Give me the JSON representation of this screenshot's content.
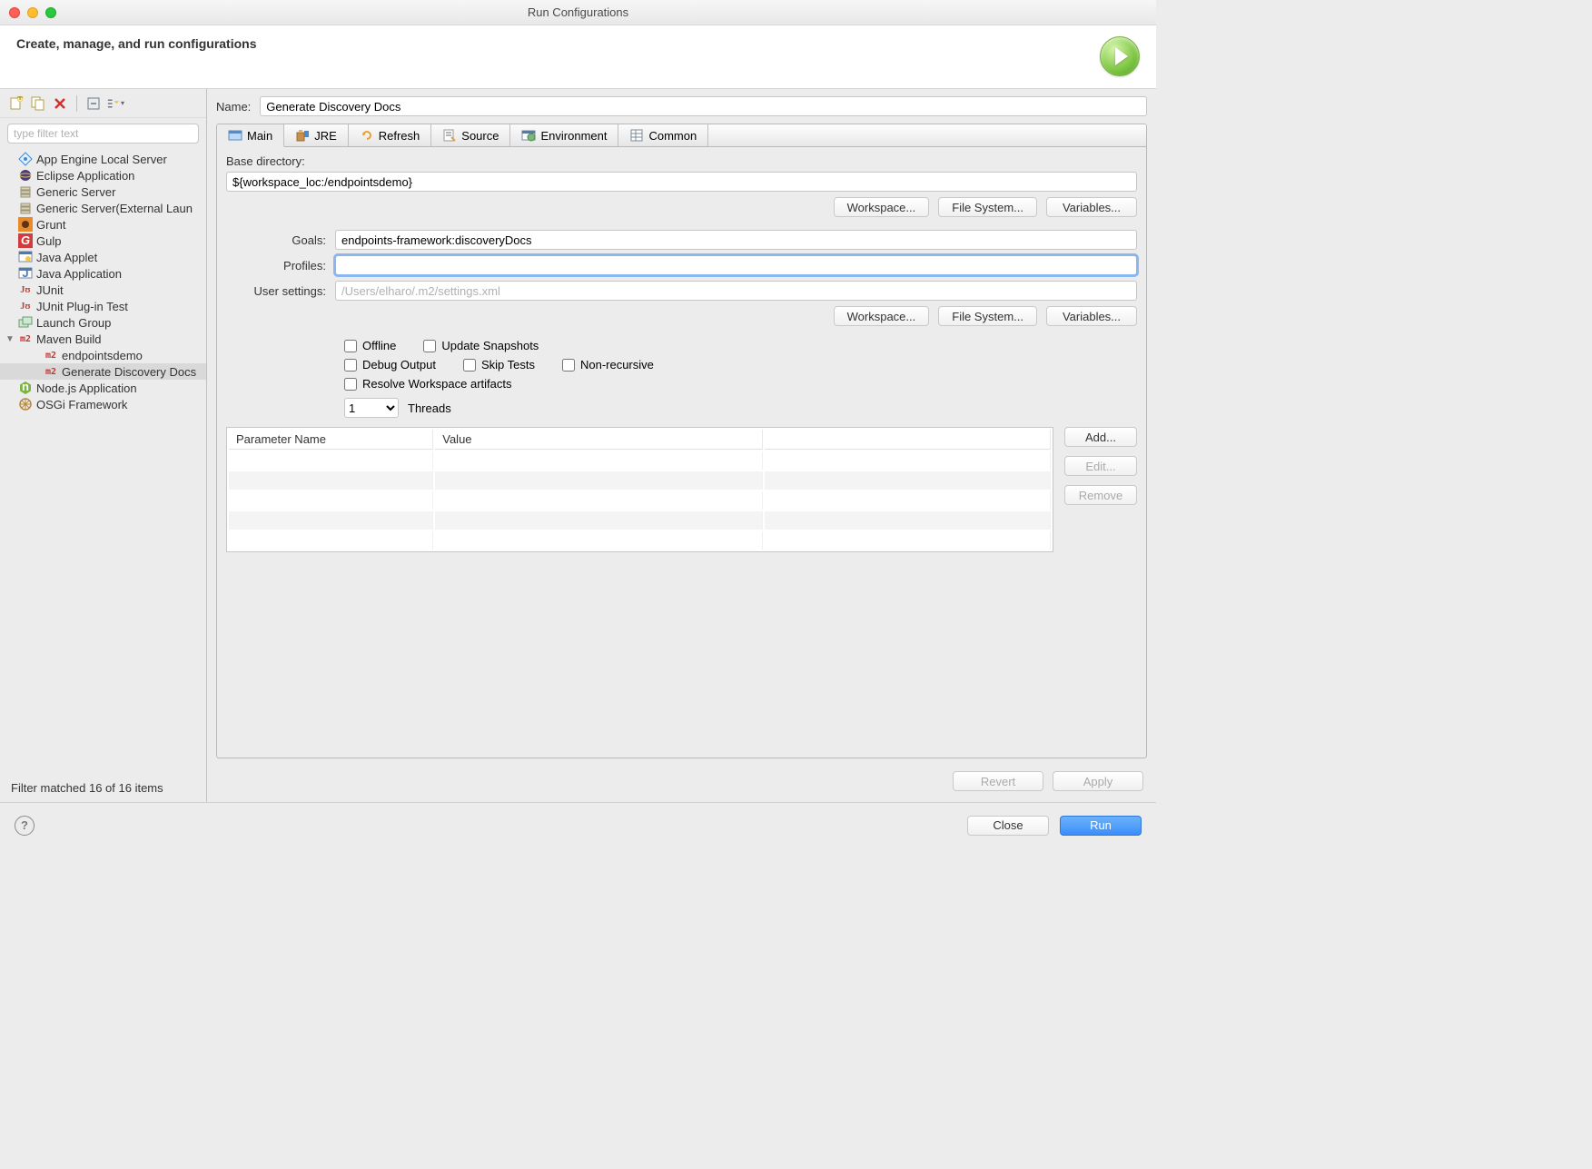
{
  "window": {
    "title": "Run Configurations"
  },
  "header": {
    "title": "Create, manage, and run configurations"
  },
  "left": {
    "filter_placeholder": "type filter text",
    "items": [
      {
        "label": "App Engine Local Server"
      },
      {
        "label": "Eclipse Application"
      },
      {
        "label": "Generic Server"
      },
      {
        "label": "Generic Server(External Laun"
      },
      {
        "label": "Grunt"
      },
      {
        "label": "Gulp"
      },
      {
        "label": "Java Applet"
      },
      {
        "label": "Java Application"
      },
      {
        "label": "JUnit"
      },
      {
        "label": "JUnit Plug-in Test"
      },
      {
        "label": "Launch Group"
      },
      {
        "label": "Maven Build",
        "expanded": true,
        "children": [
          {
            "label": "endpointsdemo"
          },
          {
            "label": "Generate Discovery Docs",
            "selected": true
          }
        ]
      },
      {
        "label": "Node.js Application"
      },
      {
        "label": "OSGi Framework"
      }
    ],
    "status": "Filter matched 16 of 16 items"
  },
  "right": {
    "name_label": "Name:",
    "name_value": "Generate Discovery Docs",
    "tabs": {
      "main": "Main",
      "jre": "JRE",
      "refresh": "Refresh",
      "source": "Source",
      "environment": "Environment",
      "common": "Common"
    },
    "main_tab": {
      "base_directory_label": "Base directory:",
      "base_directory_value": "${workspace_loc:/endpointsdemo}",
      "workspace_btn": "Workspace...",
      "filesystem_btn": "File System...",
      "variables_btn": "Variables...",
      "goals_label": "Goals:",
      "goals_value": "endpoints-framework:discoveryDocs",
      "profiles_label": "Profiles:",
      "profiles_value": "",
      "usersettings_label": "User settings:",
      "usersettings_placeholder": "/Users/elharo/.m2/settings.xml",
      "workspace_btn2": "Workspace...",
      "filesystem_btn2": "File System...",
      "variables_btn2": "Variables...",
      "chk_offline": "Offline",
      "chk_update": "Update Snapshots",
      "chk_debug": "Debug Output",
      "chk_skip": "Skip Tests",
      "chk_nonrec": "Non-recursive",
      "chk_resolve": "Resolve Workspace artifacts",
      "threads_value": "1",
      "threads_label": "Threads",
      "table": {
        "col1": "Parameter Name",
        "col2": "Value"
      },
      "add_btn": "Add...",
      "edit_btn": "Edit...",
      "remove_btn": "Remove"
    },
    "revert_btn": "Revert",
    "apply_btn": "Apply"
  },
  "footer": {
    "close_btn": "Close",
    "run_btn": "Run"
  }
}
